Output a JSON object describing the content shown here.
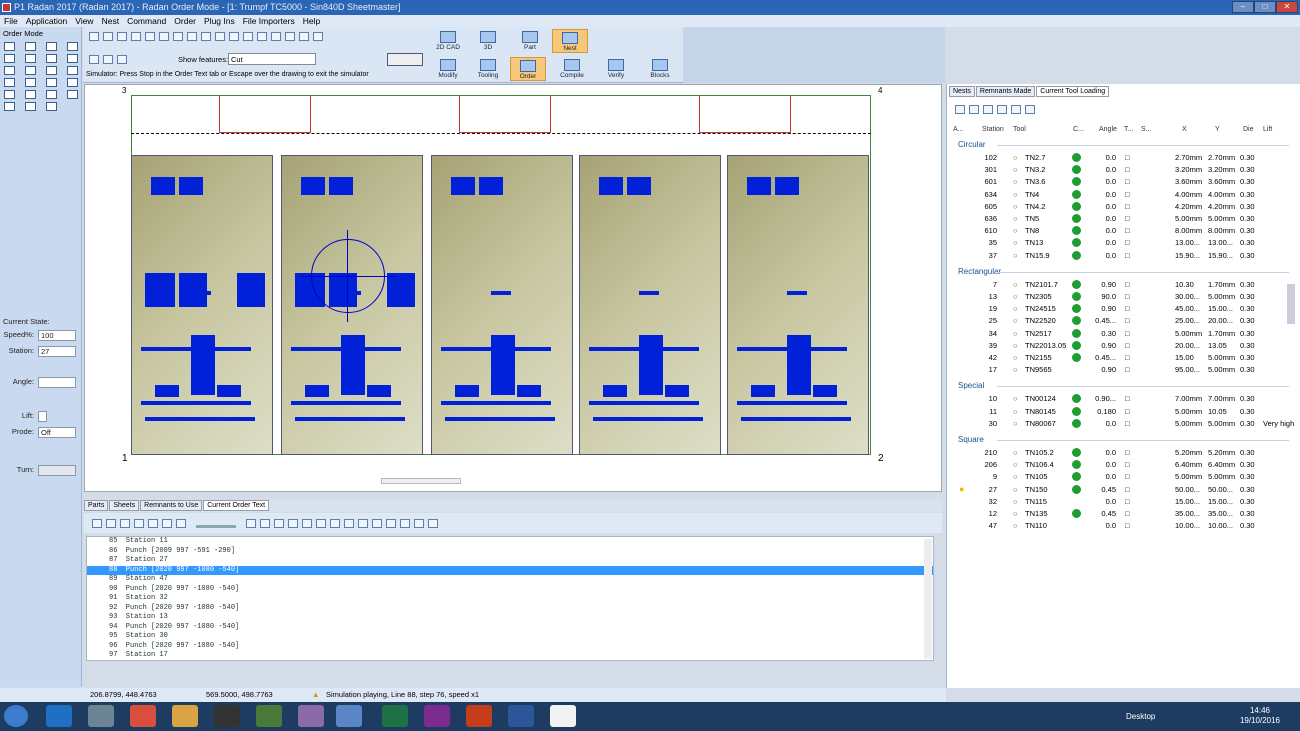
{
  "window": {
    "title": "P1 Radan 2017 (Radan 2017) - Radan Order Mode - [1: Trumpf TC5000 - Sin840D Sheetmaster]"
  },
  "menu": [
    "File",
    "Application",
    "View",
    "Nest",
    "Command",
    "Order",
    "Plug Ins",
    "File Importers",
    "Help"
  ],
  "left_panel": {
    "title": "Order Mode",
    "current_state": "Current State:",
    "speed_label": "Speed%:",
    "speed_value": "100",
    "station_label": "Station:",
    "station_value": "27",
    "angle_label": "Angle:",
    "angle_value": "",
    "lift_label": "Lift:",
    "prode_label": "Prode:",
    "prode_value": "Off",
    "turn_label": "Turn:"
  },
  "ribbon": {
    "show_features_label": "Show features:",
    "show_features_value": "Cut",
    "simulator_msg": "Simulator: Press Stop in the Order Text tab or Escape over the drawing to exit the simulator",
    "modes": [
      {
        "label": "2D CAD"
      },
      {
        "label": "3D"
      },
      {
        "label": "Part"
      },
      {
        "label": "Nest"
      },
      {
        "label": "Modify"
      },
      {
        "label": "Tooling"
      },
      {
        "label": "Order"
      },
      {
        "label": "Compile"
      },
      {
        "label": "Verify"
      },
      {
        "label": "Blocks"
      }
    ]
  },
  "canvas": {
    "sheet_numbers": [
      "1",
      "2",
      "3",
      "4"
    ]
  },
  "bottom_tabs": [
    "Parts",
    "Sheets",
    "Remnants to Use",
    "Current Order Text"
  ],
  "order_text": [
    "85  Station 11",
    "86  Punch [2009 997 -591 -290]",
    "87  Station 27",
    "88  Punch [2020 997 -1080 -540]",
    "89  Station 47",
    "90  Punch [2020 997 -1080 -540]",
    "91  Station 32",
    "92  Punch [2020 997 -1080 -540]",
    "93  Station 13",
    "94  Punch [2020 997 -1080 -540]",
    "95  Station 30",
    "96  Punch [2020 997 -1080 -540]",
    "97  Station 17"
  ],
  "selected_line": 3,
  "right_panel": {
    "tabs": [
      "Nests",
      "Remnants Made",
      "Current Tool Loading"
    ],
    "headers": [
      "A...",
      "Station",
      "Tool",
      "C...",
      "Angle",
      "T...",
      "S...",
      "X",
      "Y",
      "Die",
      "Lift"
    ],
    "groups": [
      {
        "name": "Circular",
        "rows": [
          [
            "102",
            "TN2.7",
            "0.0",
            "2.70mm",
            "2.70mm",
            "0.30",
            ""
          ],
          [
            "301",
            "TN3.2",
            "0.0",
            "3.20mm",
            "3.20mm",
            "0.30",
            ""
          ],
          [
            "601",
            "TN3.6",
            "0.0",
            "3.60mm",
            "3.60mm",
            "0.30",
            ""
          ],
          [
            "634",
            "TN4",
            "0.0",
            "4.00mm",
            "4.00mm",
            "0.30",
            ""
          ],
          [
            "605",
            "TN4.2",
            "0.0",
            "4.20mm",
            "4.20mm",
            "0.30",
            ""
          ],
          [
            "636",
            "TN5",
            "0.0",
            "5.00mm",
            "5.00mm",
            "0.30",
            ""
          ],
          [
            "610",
            "TN8",
            "0.0",
            "8.00mm",
            "8.00mm",
            "0.30",
            ""
          ],
          [
            "35",
            "TN13",
            "0.0",
            "13.00...",
            "13.00...",
            "0.30",
            ""
          ],
          [
            "37",
            "TN15.9",
            "0.0",
            "15.90...",
            "15.90...",
            "0.30",
            ""
          ]
        ]
      },
      {
        "name": "Rectangular",
        "rows": [
          [
            "7",
            "TN2101.7",
            "0.90",
            "10.30",
            "1.70mm",
            "0.30",
            ""
          ],
          [
            "13",
            "TN2305",
            "90.0",
            "30.00...",
            "5.00mm",
            "0.30",
            ""
          ],
          [
            "19",
            "TN24515",
            "0.90",
            "45.00...",
            "15.00...",
            "0.30",
            ""
          ],
          [
            "25",
            "TN22520",
            "0.45...",
            "25.00...",
            "20.00...",
            "0.30",
            ""
          ],
          [
            "34",
            "TN2517",
            "0.30",
            "5.00mm",
            "1.70mm",
            "0.30",
            ""
          ],
          [
            "39",
            "TN22013.05",
            "0.90",
            "20.00...",
            "13.05",
            "0.30",
            ""
          ],
          [
            "42",
            "TN2155",
            "0.45...",
            "15.00",
            "5.00mm",
            "0.30",
            ""
          ],
          [
            "17",
            "TN9565",
            "0.90",
            "95.00...",
            "5.00mm",
            "0.30",
            ""
          ]
        ]
      },
      {
        "name": "Special",
        "rows": [
          [
            "10",
            "TN00124",
            "0.90...",
            "7.00mm",
            "7.00mm",
            "0.30",
            ""
          ],
          [
            "11",
            "TN80145",
            "0.180",
            "5.00mm",
            "10.05",
            "0.30",
            ""
          ],
          [
            "30",
            "TN80067",
            "0.0",
            "5.00mm",
            "5.00mm",
            "0.30",
            "Very high"
          ]
        ]
      },
      {
        "name": "Square",
        "rows": [
          [
            "210",
            "TN105.2",
            "0.0",
            "5.20mm",
            "5.20mm",
            "0.30",
            ""
          ],
          [
            "206",
            "TN106.4",
            "0.0",
            "6.40mm",
            "6.40mm",
            "0.30",
            ""
          ],
          [
            "9",
            "TN105",
            "0.0",
            "5.00mm",
            "5.00mm",
            "0.30",
            ""
          ],
          [
            "27",
            "TN150",
            "0.45",
            "50.00...",
            "50.00...",
            "0.30",
            ""
          ],
          [
            "32",
            "TN115",
            "0.0",
            "15.00...",
            "15.00...",
            "0.30",
            ""
          ],
          [
            "12",
            "TN135",
            "0.45",
            "35.00...",
            "35.00...",
            "0.30",
            ""
          ],
          [
            "47",
            "TN110",
            "0.0",
            "10.00...",
            "10.00...",
            "0.30",
            ""
          ]
        ]
      }
    ]
  },
  "status": {
    "coord1": "206.8799, 448.4763",
    "coord2": "569.5000, 498.7763",
    "message": "Simulation playing, Line 88, step 76, speed x1"
  },
  "taskbar": {
    "desktop": "Desktop",
    "time": "14:46",
    "date": "19/10/2016"
  }
}
